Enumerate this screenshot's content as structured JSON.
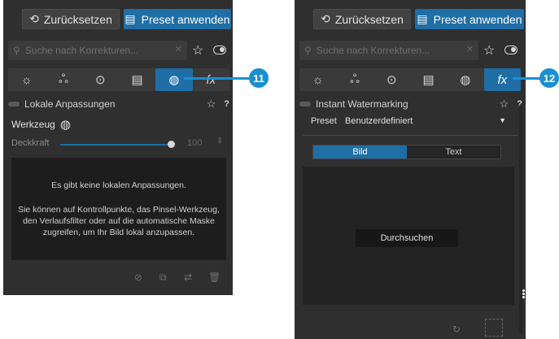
{
  "left": {
    "reset_label": "Zurücksetzen",
    "preset_label": "Preset anwenden",
    "search_placeholder": "Suche nach Korrekturen...",
    "tabs": [
      {
        "icon": "sun-icon",
        "glyph": "☼"
      },
      {
        "icon": "color-icon",
        "glyph": "ஃ"
      },
      {
        "icon": "detail-icon",
        "glyph": "⊙"
      },
      {
        "icon": "geometry-icon",
        "glyph": "▤"
      },
      {
        "icon": "local-adjust-icon",
        "glyph": "◍"
      },
      {
        "icon": "fx-icon",
        "glyph": "fx"
      }
    ],
    "section_title": "Lokale Anpassungen",
    "tool_label": "Werkzeug",
    "opacity_label": "Deckkraft",
    "opacity_value": "100",
    "message_title": "Es gibt keine lokalen Anpassungen.",
    "message_body": "Sie können auf Kontrollpunkte, das Pinsel-Werkzeug, den Verlaufsfilter oder auf die automatische Maske zugreifen, um Ihr Bild lokal anzupassen.",
    "callout": "11"
  },
  "right": {
    "reset_label": "Zurücksetzen",
    "preset_label": "Preset anwenden",
    "search_placeholder": "Suche nach Korrekturen...",
    "section_title": "Instant Watermarking",
    "preset_field_label": "Preset",
    "preset_value": "Benutzerdefiniert",
    "segments": [
      "Bild",
      "Text"
    ],
    "browse_label": "Durchsuchen",
    "callout": "12"
  },
  "colors": {
    "panel_bg": "#2f2f2f",
    "accent_blue": "#1f6ea6",
    "callout_blue": "#1a8fd2"
  }
}
